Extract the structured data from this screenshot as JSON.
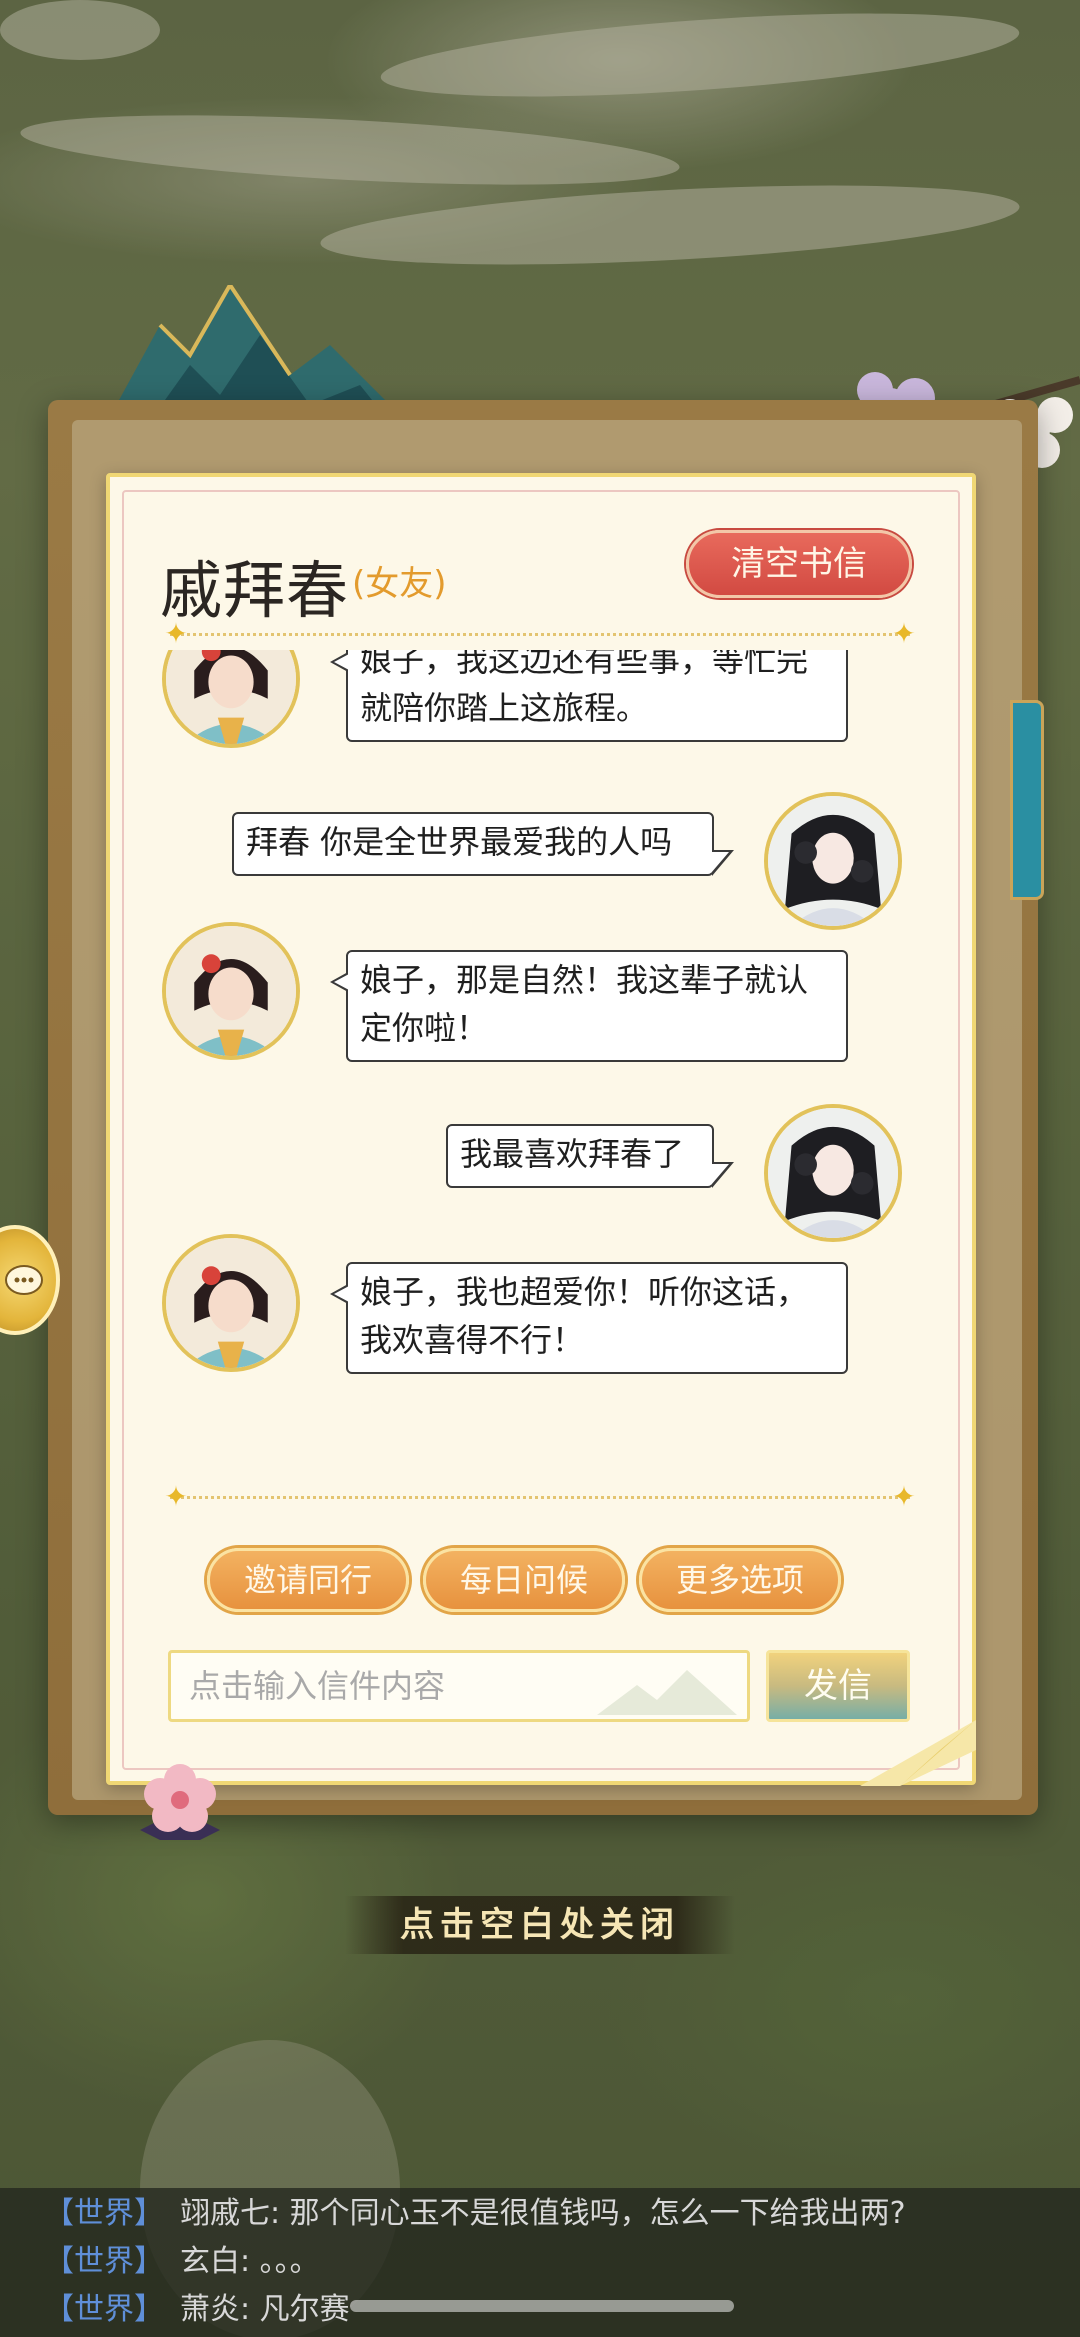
{
  "letter": {
    "contact_name": "戚拜春",
    "contact_tag": "(女友)",
    "clear_button": "清空书信"
  },
  "messages": [
    {
      "from": "partner",
      "text_line1": "娘子，我这边还有些事，等忙完",
      "text_line2": "就陪你踏上这旅程。"
    },
    {
      "from": "self",
      "text_line1": "拜春 你是全世界最爱我的人吗"
    },
    {
      "from": "partner",
      "text_line1": "娘子，那是自然！我这辈子就认",
      "text_line2": "定你啦！"
    },
    {
      "from": "self",
      "text_line1": "我最喜欢拜春了"
    },
    {
      "from": "partner",
      "text_line1": "娘子，我也超爱你！听你这话，",
      "text_line2": "我欢喜得不行！"
    }
  ],
  "actions": {
    "invite": "邀请同行",
    "daily_greeting": "每日问候",
    "more_options": "更多选项"
  },
  "compose": {
    "placeholder": "点击输入信件内容",
    "send": "发信"
  },
  "close_hint": "点击空白处关闭",
  "world_chat": [
    {
      "channel": "【世界】",
      "text": "翊戚七: 那个同心玉不是很值钱吗，怎么一下给我出两?"
    },
    {
      "channel": "【世界】",
      "text": "玄白: 。。。"
    },
    {
      "channel": "【世界】",
      "text": "萧炎: 凡尔赛"
    }
  ],
  "colors": {
    "paper": "#fdf8e8",
    "clear_button": "#d24a42",
    "action_button": "#e7923e",
    "send_button": "#77aea6",
    "world_channel": "#5f8fd8"
  }
}
